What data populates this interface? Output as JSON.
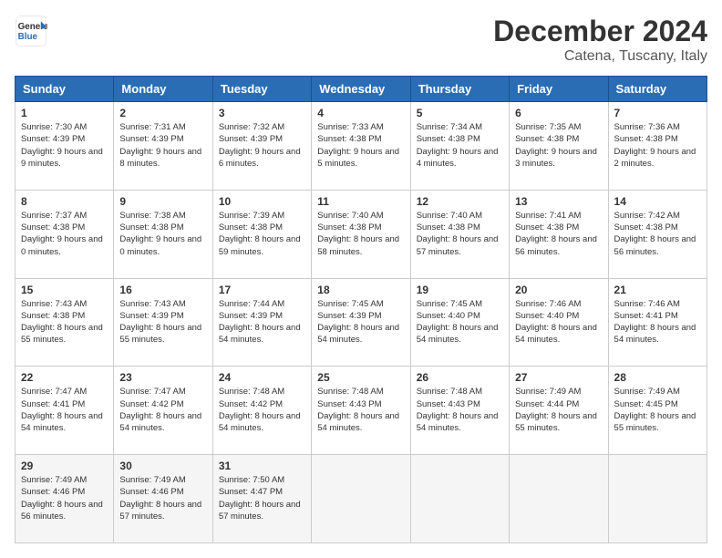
{
  "logo": {
    "line1": "General",
    "line2": "Blue"
  },
  "title": "December 2024",
  "location": "Catena, Tuscany, Italy",
  "days_of_week": [
    "Sunday",
    "Monday",
    "Tuesday",
    "Wednesday",
    "Thursday",
    "Friday",
    "Saturday"
  ],
  "weeks": [
    [
      {
        "day": "1",
        "sunrise": "7:30 AM",
        "sunset": "4:39 PM",
        "daylight": "9 hours and 9 minutes."
      },
      {
        "day": "2",
        "sunrise": "7:31 AM",
        "sunset": "4:39 PM",
        "daylight": "9 hours and 8 minutes."
      },
      {
        "day": "3",
        "sunrise": "7:32 AM",
        "sunset": "4:39 PM",
        "daylight": "9 hours and 6 minutes."
      },
      {
        "day": "4",
        "sunrise": "7:33 AM",
        "sunset": "4:38 PM",
        "daylight": "9 hours and 5 minutes."
      },
      {
        "day": "5",
        "sunrise": "7:34 AM",
        "sunset": "4:38 PM",
        "daylight": "9 hours and 4 minutes."
      },
      {
        "day": "6",
        "sunrise": "7:35 AM",
        "sunset": "4:38 PM",
        "daylight": "9 hours and 3 minutes."
      },
      {
        "day": "7",
        "sunrise": "7:36 AM",
        "sunset": "4:38 PM",
        "daylight": "9 hours and 2 minutes."
      }
    ],
    [
      {
        "day": "8",
        "sunrise": "7:37 AM",
        "sunset": "4:38 PM",
        "daylight": "9 hours and 0 minutes."
      },
      {
        "day": "9",
        "sunrise": "7:38 AM",
        "sunset": "4:38 PM",
        "daylight": "9 hours and 0 minutes."
      },
      {
        "day": "10",
        "sunrise": "7:39 AM",
        "sunset": "4:38 PM",
        "daylight": "8 hours and 59 minutes."
      },
      {
        "day": "11",
        "sunrise": "7:40 AM",
        "sunset": "4:38 PM",
        "daylight": "8 hours and 58 minutes."
      },
      {
        "day": "12",
        "sunrise": "7:40 AM",
        "sunset": "4:38 PM",
        "daylight": "8 hours and 57 minutes."
      },
      {
        "day": "13",
        "sunrise": "7:41 AM",
        "sunset": "4:38 PM",
        "daylight": "8 hours and 56 minutes."
      },
      {
        "day": "14",
        "sunrise": "7:42 AM",
        "sunset": "4:38 PM",
        "daylight": "8 hours and 56 minutes."
      }
    ],
    [
      {
        "day": "15",
        "sunrise": "7:43 AM",
        "sunset": "4:38 PM",
        "daylight": "8 hours and 55 minutes."
      },
      {
        "day": "16",
        "sunrise": "7:43 AM",
        "sunset": "4:39 PM",
        "daylight": "8 hours and 55 minutes."
      },
      {
        "day": "17",
        "sunrise": "7:44 AM",
        "sunset": "4:39 PM",
        "daylight": "8 hours and 54 minutes."
      },
      {
        "day": "18",
        "sunrise": "7:45 AM",
        "sunset": "4:39 PM",
        "daylight": "8 hours and 54 minutes."
      },
      {
        "day": "19",
        "sunrise": "7:45 AM",
        "sunset": "4:40 PM",
        "daylight": "8 hours and 54 minutes."
      },
      {
        "day": "20",
        "sunrise": "7:46 AM",
        "sunset": "4:40 PM",
        "daylight": "8 hours and 54 minutes."
      },
      {
        "day": "21",
        "sunrise": "7:46 AM",
        "sunset": "4:41 PM",
        "daylight": "8 hours and 54 minutes."
      }
    ],
    [
      {
        "day": "22",
        "sunrise": "7:47 AM",
        "sunset": "4:41 PM",
        "daylight": "8 hours and 54 minutes."
      },
      {
        "day": "23",
        "sunrise": "7:47 AM",
        "sunset": "4:42 PM",
        "daylight": "8 hours and 54 minutes."
      },
      {
        "day": "24",
        "sunrise": "7:48 AM",
        "sunset": "4:42 PM",
        "daylight": "8 hours and 54 minutes."
      },
      {
        "day": "25",
        "sunrise": "7:48 AM",
        "sunset": "4:43 PM",
        "daylight": "8 hours and 54 minutes."
      },
      {
        "day": "26",
        "sunrise": "7:48 AM",
        "sunset": "4:43 PM",
        "daylight": "8 hours and 54 minutes."
      },
      {
        "day": "27",
        "sunrise": "7:49 AM",
        "sunset": "4:44 PM",
        "daylight": "8 hours and 55 minutes."
      },
      {
        "day": "28",
        "sunrise": "7:49 AM",
        "sunset": "4:45 PM",
        "daylight": "8 hours and 55 minutes."
      }
    ],
    [
      {
        "day": "29",
        "sunrise": "7:49 AM",
        "sunset": "4:46 PM",
        "daylight": "8 hours and 56 minutes."
      },
      {
        "day": "30",
        "sunrise": "7:49 AM",
        "sunset": "4:46 PM",
        "daylight": "8 hours and 57 minutes."
      },
      {
        "day": "31",
        "sunrise": "7:50 AM",
        "sunset": "4:47 PM",
        "daylight": "8 hours and 57 minutes."
      },
      null,
      null,
      null,
      null
    ]
  ]
}
